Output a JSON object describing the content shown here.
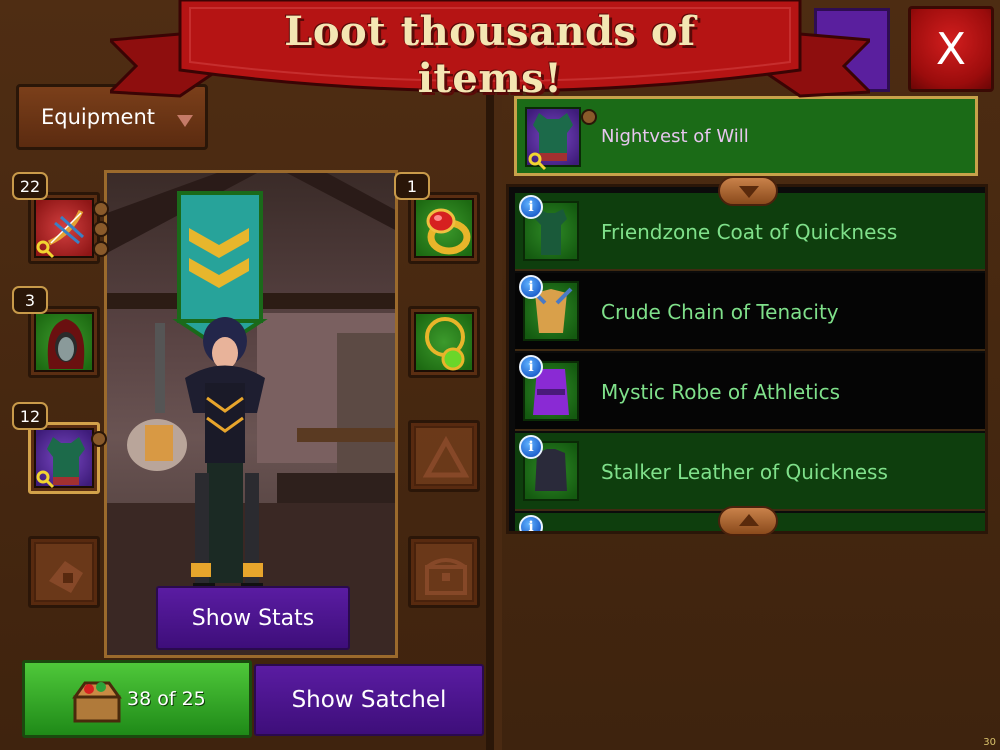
{
  "banner": {
    "title": "Loot thousands of items!"
  },
  "close_button": {
    "label": "X"
  },
  "equipment_dropdown": {
    "label": "Equipment"
  },
  "left_slots": [
    {
      "name": "weapon",
      "count": "22",
      "icon": "bow-and-arrows-icon",
      "rarity": "red"
    },
    {
      "name": "head",
      "count": "3",
      "icon": "hood-icon",
      "rarity": "green"
    },
    {
      "name": "chest",
      "count": "12",
      "icon": "vest-icon",
      "rarity": "purple",
      "selected": true
    },
    {
      "name": "gloves",
      "count": "",
      "icon": "glove-icon",
      "rarity": "empty"
    }
  ],
  "right_slots": [
    {
      "name": "ring",
      "count": "1",
      "icon": "ring-icon",
      "rarity": "green"
    },
    {
      "name": "amulet",
      "count": "",
      "icon": "amulet-icon",
      "rarity": "green"
    },
    {
      "name": "trinket",
      "count": "",
      "icon": "triangle-icon",
      "rarity": "empty"
    },
    {
      "name": "chest-storage",
      "count": "",
      "icon": "treasure-chest-icon",
      "rarity": "empty"
    }
  ],
  "show_stats": {
    "label": "Show Stats"
  },
  "satchel": {
    "count_text": "38 of 25",
    "button_label": "Show Satchel"
  },
  "selected_item": {
    "name": "Nightvest of Will",
    "icon": "vest-icon"
  },
  "item_list": [
    {
      "name": "Friendzone Coat of Quickness",
      "icon": "coat-icon",
      "row": "green"
    },
    {
      "name": "Crude Chain of Tenacity",
      "icon": "chain-armor-icon",
      "row": "black"
    },
    {
      "name": "Mystic Robe of Athletics",
      "icon": "robe-icon",
      "row": "black"
    },
    {
      "name": "Stalker Leather of Quickness",
      "icon": "leather-armor-icon",
      "row": "green"
    }
  ],
  "fps": "30",
  "colors": {
    "accent_purple": "#5a1ca2",
    "accent_green": "#1f8a18",
    "banner_red": "#b51414",
    "item_text": "#7fe08a"
  }
}
